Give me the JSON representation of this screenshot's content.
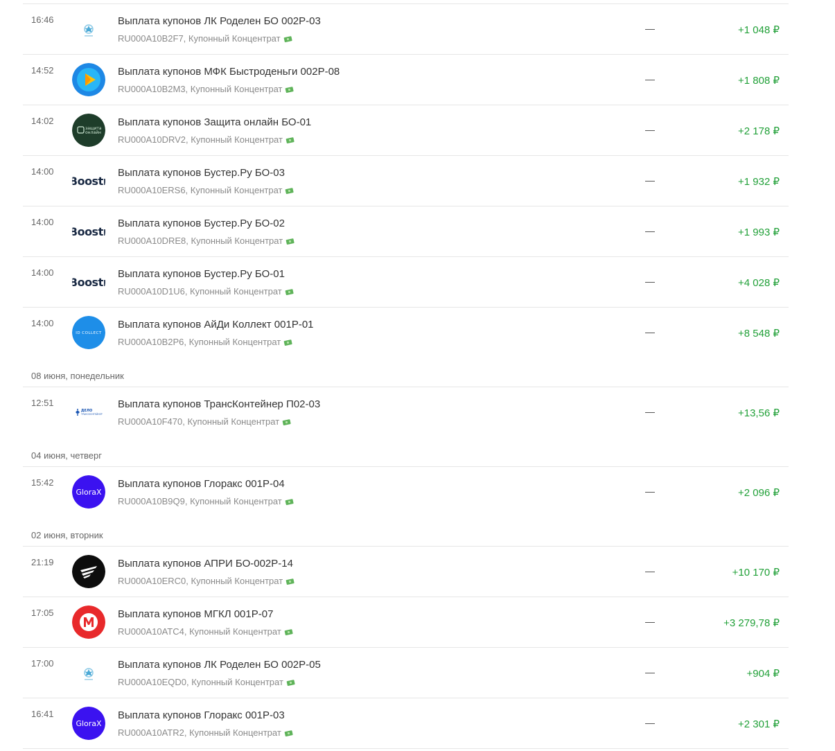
{
  "groups": [
    {
      "date": "",
      "items": [
        {
          "time": "16:46",
          "logo": "rodelen-logo",
          "title": "Выплата купонов ЛК Роделен БО 002Р-03",
          "sub": "RU000A10B2F7, Купонный Концентрат",
          "dash": "—",
          "amount": "+1 048 ₽"
        },
        {
          "time": "14:52",
          "logo": "bystrodengi-logo",
          "title": "Выплата купонов МФК Быстроденьги 002Р-08",
          "sub": "RU000A10B2M3, Купонный Концентрат",
          "dash": "—",
          "amount": "+1 808 ₽"
        },
        {
          "time": "14:02",
          "logo": "zashchita-logo",
          "title": "Выплата купонов Защита онлайн БО-01",
          "sub": "RU000A10DRV2, Купонный Концентрат",
          "dash": "—",
          "amount": "+2 178 ₽"
        },
        {
          "time": "14:00",
          "logo": "boostr-logo",
          "title": "Выплата купонов Бустер.Ру БО-03",
          "sub": "RU000A10ERS6, Купонный Концентрат",
          "dash": "—",
          "amount": "+1 932 ₽"
        },
        {
          "time": "14:00",
          "logo": "boostr-logo",
          "title": "Выплата купонов Бустер.Ру БО-02",
          "sub": "RU000A10DRE8, Купонный Концентрат",
          "dash": "—",
          "amount": "+1 993 ₽"
        },
        {
          "time": "14:00",
          "logo": "boostr-logo",
          "title": "Выплата купонов Бустер.Ру БО-01",
          "sub": "RU000A10D1U6, Купонный Концентрат",
          "dash": "—",
          "amount": "+4 028 ₽"
        },
        {
          "time": "14:00",
          "logo": "idcollect-logo",
          "title": "Выплата купонов АйДи Коллект 001Р-01",
          "sub": "RU000A10B2P6, Купонный Концентрат",
          "dash": "—",
          "amount": "+8 548 ₽"
        }
      ]
    },
    {
      "date": "08 июня, понедельник",
      "items": [
        {
          "time": "12:51",
          "logo": "delo-logo",
          "title": "Выплата купонов ТрансКонтейнер П02-03",
          "sub": "RU000A10F470, Купонный Концентрат",
          "dash": "—",
          "amount": "+13,56 ₽"
        }
      ]
    },
    {
      "date": "04 июня, четверг",
      "items": [
        {
          "time": "15:42",
          "logo": "glorax-logo",
          "title": "Выплата купонов Глоракс 001Р-04",
          "sub": "RU000A10B9Q9, Купонный Концентрат",
          "dash": "—",
          "amount": "+2 096 ₽"
        }
      ]
    },
    {
      "date": "02 июня, вторник",
      "items": [
        {
          "time": "21:19",
          "logo": "apri-logo",
          "title": "Выплата купонов АПРИ БО-002Р-14",
          "sub": "RU000A10ERC0, Купонный Концентрат",
          "dash": "—",
          "amount": "+10 170 ₽"
        },
        {
          "time": "17:05",
          "logo": "mgkl-logo",
          "title": "Выплата купонов МГКЛ 001Р-07",
          "sub": "RU000A10ATC4, Купонный Концентрат",
          "dash": "—",
          "amount": "+3 279,78 ₽"
        },
        {
          "time": "17:00",
          "logo": "rodelen-logo",
          "title": "Выплата купонов ЛК Роделен БО 002Р-05",
          "sub": "RU000A10EQD0, Купонный Концентрат",
          "dash": "—",
          "amount": "+904 ₽"
        },
        {
          "time": "16:41",
          "logo": "glorax-logo",
          "title": "Выплата купонов Глоракс 001Р-03",
          "sub": "RU000A10ATR2, Купонный Концентрат",
          "dash": "—",
          "amount": "+2 301 ₽"
        }
      ]
    }
  ],
  "logo_text": {
    "zashchita": [
      "защита",
      "онлайн"
    ],
    "boostr": "Boostr",
    "idcollect": "ID COLLECT",
    "delo": [
      "ДЕЛО",
      "ТРАНСКОНТЕЙНЕР"
    ],
    "glorax": "GloraX"
  },
  "colors": {
    "amount_green": "#21a038",
    "bystrodengi_blue": "#1e88e5",
    "zashchita_green": "#1e3d2a",
    "idcollect_blue": "#1e8ee8",
    "glorax_purple": "#3b12f0",
    "mgkl_red": "#e8292b"
  }
}
